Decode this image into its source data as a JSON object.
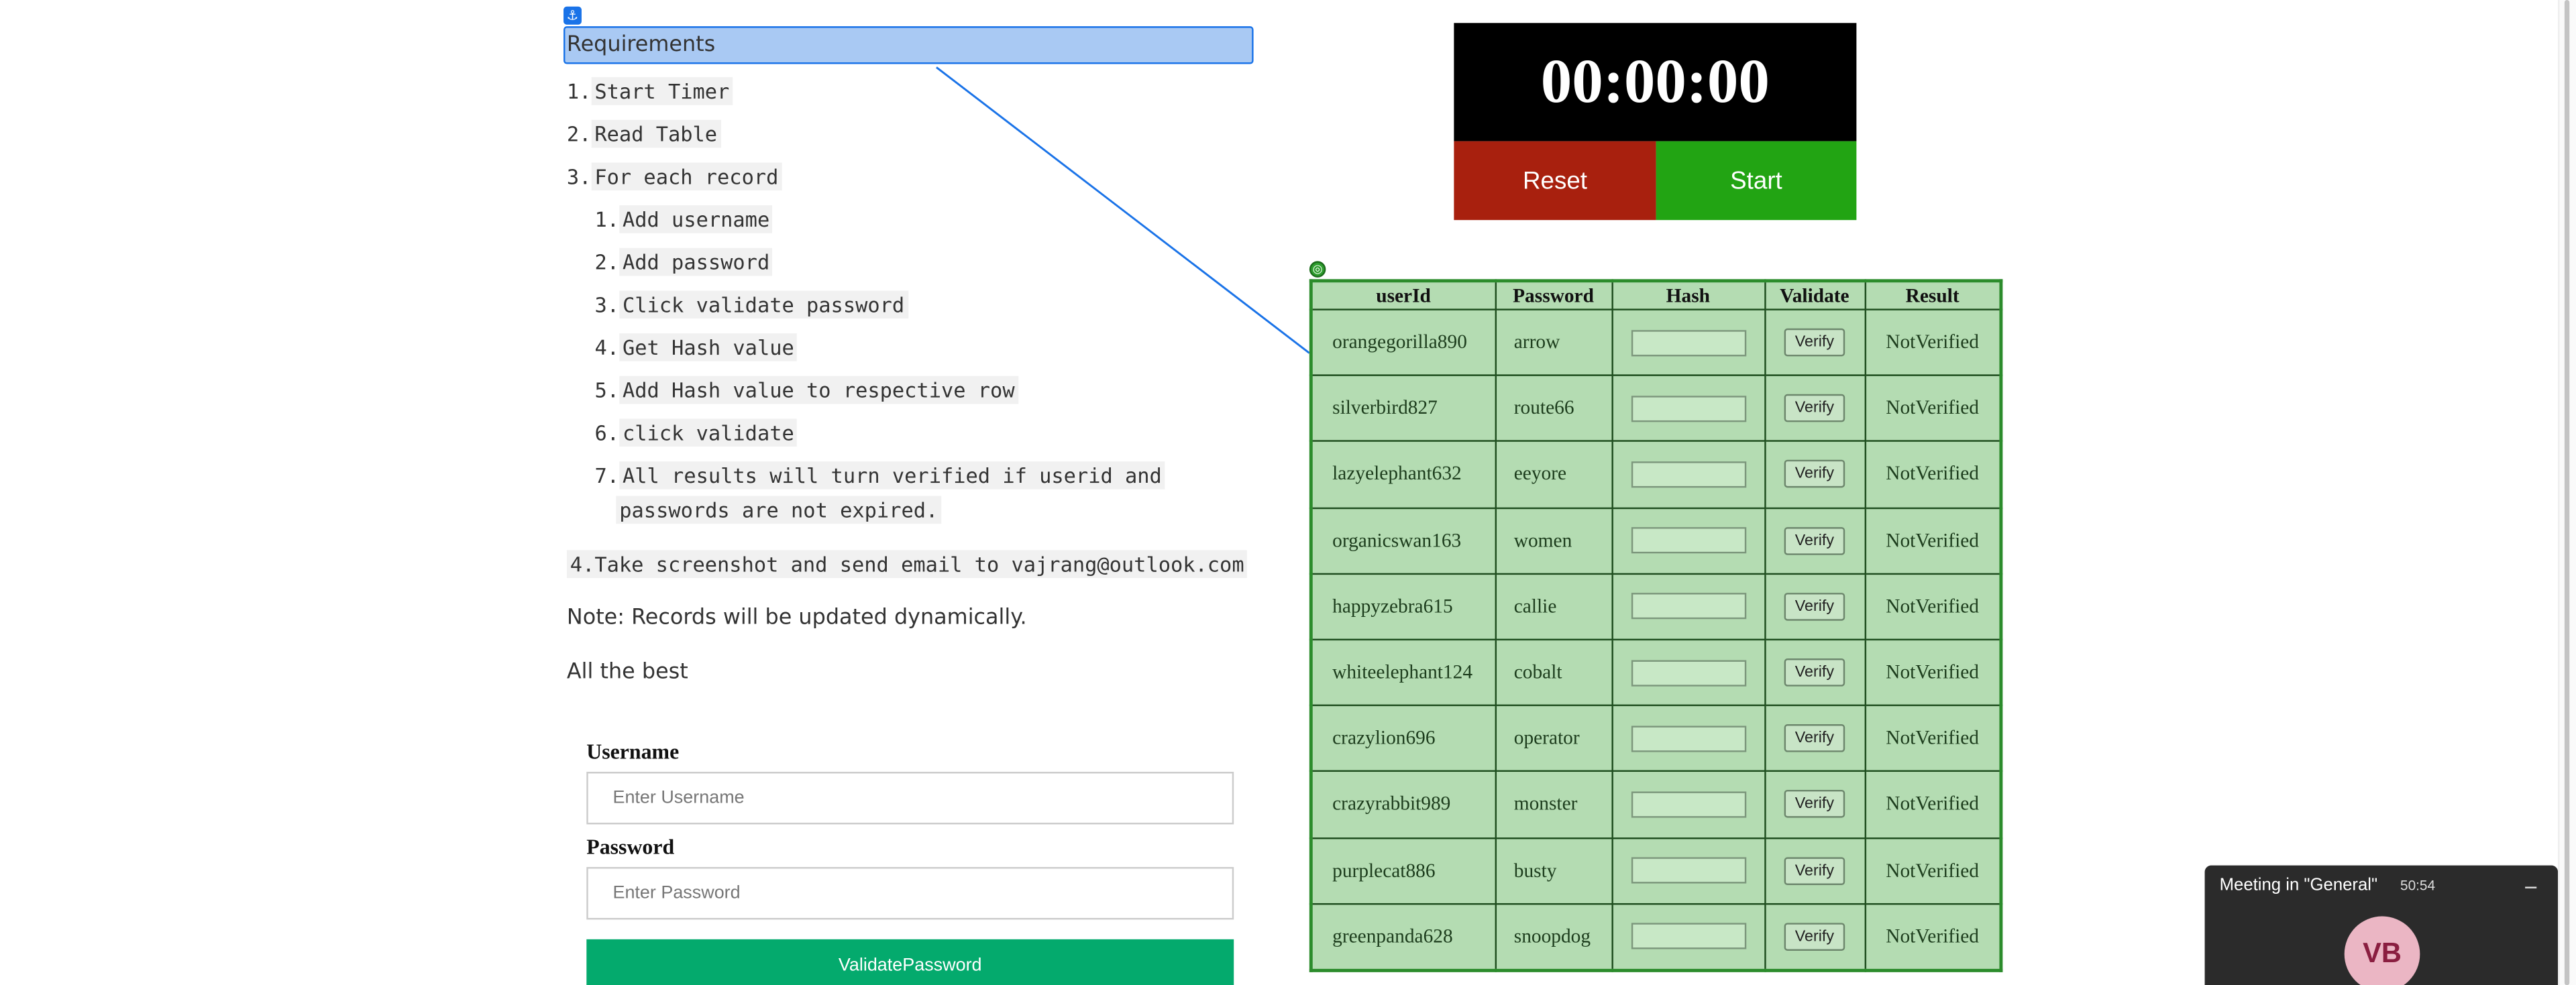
{
  "requirements": {
    "heading": "Requirements",
    "steps": [
      {
        "num": "1.",
        "text": "Start Timer"
      },
      {
        "num": "2.",
        "text": "Read Table"
      },
      {
        "num": "3.",
        "text": "For each record"
      }
    ],
    "substeps": [
      {
        "num": "1.",
        "text": "Add username"
      },
      {
        "num": "2.",
        "text": "Add password"
      },
      {
        "num": "3.",
        "text": "Click validate password"
      },
      {
        "num": "4.",
        "text": "Get Hash value"
      },
      {
        "num": "5.",
        "text": "Add Hash value to respective row"
      },
      {
        "num": "6.",
        "text": "click validate"
      },
      {
        "num": "7.",
        "text": "All results will turn verified if userid and",
        "text2": "passwords are not expired."
      }
    ],
    "step4": "4.Take screenshot and send email to vajrang@outlook.com",
    "note": "Note: Records will be updated dynamically.",
    "closing": "All the best"
  },
  "form": {
    "username_label": "Username",
    "username_placeholder": "Enter Username",
    "password_label": "Password",
    "password_placeholder": "Enter Password",
    "validate_label": "ValidatePassword"
  },
  "timer": {
    "display": "00:00:00",
    "reset_label": "Reset",
    "start_label": "Start"
  },
  "table": {
    "headers": [
      "userId",
      "Password",
      "Hash",
      "Validate",
      "Result"
    ],
    "verify_label": "Verify",
    "rows": [
      {
        "user": "orangegorilla890",
        "pass": "arrow",
        "result": "NotVerified"
      },
      {
        "user": "silverbird827",
        "pass": "route66",
        "result": "NotVerified"
      },
      {
        "user": "lazyelephant632",
        "pass": "eeyore",
        "result": "NotVerified"
      },
      {
        "user": "organicswan163",
        "pass": "women",
        "result": "NotVerified"
      },
      {
        "user": "happyzebra615",
        "pass": "callie",
        "result": "NotVerified"
      },
      {
        "user": "whiteelephant124",
        "pass": "cobalt",
        "result": "NotVerified"
      },
      {
        "user": "crazylion696",
        "pass": "operator",
        "result": "NotVerified"
      },
      {
        "user": "crazyrabbit989",
        "pass": "monster",
        "result": "NotVerified"
      },
      {
        "user": "purplecat886",
        "pass": "busty",
        "result": "NotVerified"
      },
      {
        "user": "greenpanda628",
        "pass": "snoopdog",
        "result": "NotVerified"
      }
    ]
  },
  "meeting": {
    "title": "Meeting in \"General\"",
    "time": "50:54",
    "avatar_initials": "VB"
  },
  "colors": {
    "timer_bg": "#000000",
    "reset": "#a8200e",
    "start": "#22a413",
    "validate": "#04aa6d",
    "table_bg": "#b4dcb2",
    "selection": "#a9c9f3"
  }
}
